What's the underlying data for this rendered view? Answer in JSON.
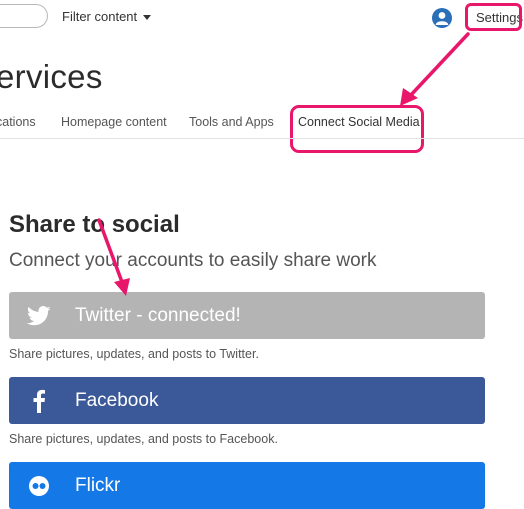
{
  "topbar": {
    "filter_label": "Filter content",
    "settings_label": "Settings"
  },
  "page": {
    "title": "ervices"
  },
  "tabs": [
    {
      "label": "cations"
    },
    {
      "label": "Homepage content"
    },
    {
      "label": "Tools and Apps"
    },
    {
      "label": "Connect Social Media"
    }
  ],
  "section": {
    "title": "Share to social",
    "subtitle": "Connect your accounts to easily share work"
  },
  "services": [
    {
      "name": "Twitter - connected!",
      "description": "Share pictures, updates, and posts to Twitter.",
      "color": "#b4b4b4",
      "icon": "twitter-bird-icon"
    },
    {
      "name": "Facebook",
      "description": "Share pictures, updates, and posts to Facebook.",
      "color": "#3b5998",
      "icon": "facebook-f-icon"
    },
    {
      "name": "Flickr",
      "color": "#1478e6",
      "icon": "flickr-dots-icon"
    }
  ],
  "annotations": {
    "highlight_color": "#e8176b"
  }
}
